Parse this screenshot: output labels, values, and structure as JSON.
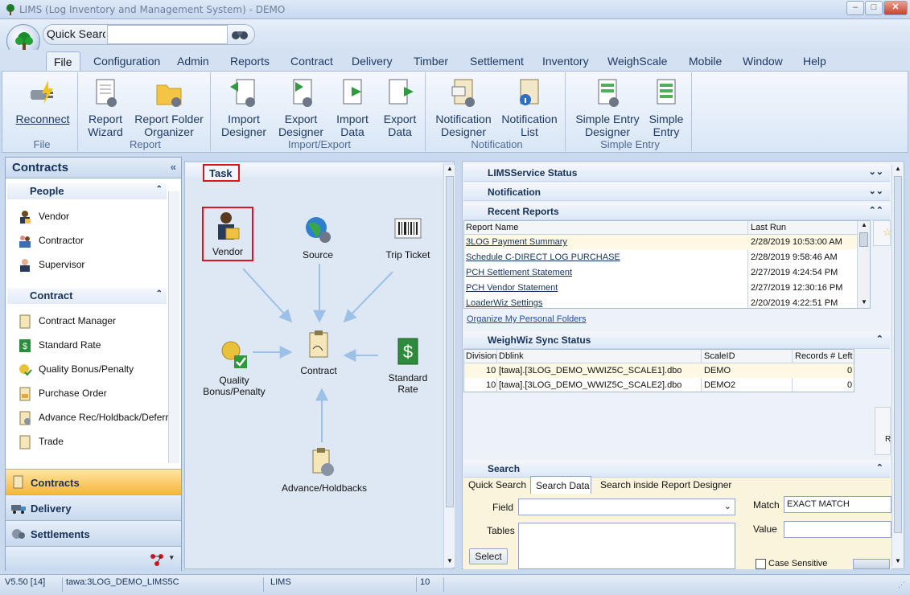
{
  "window": {
    "title": "LIMS (Log Inventory and Management System) - DEMO"
  },
  "quick_search": {
    "label": "Quick Search",
    "value": ""
  },
  "menu_tabs": [
    "File",
    "Configuration",
    "Admin",
    "Reports",
    "Contract",
    "Delivery",
    "Timber",
    "Settlement",
    "Inventory",
    "WeighScale",
    "Mobile",
    "Window",
    "Help"
  ],
  "ribbon": {
    "groups": [
      "File",
      "Report",
      "Import/Export",
      "Notification",
      "Simple Entry"
    ],
    "buttons": {
      "reconnect": "Reconnect",
      "report_wizard_1": "Report",
      "report_wizard_2": "Wizard",
      "report_folder_1": "Report Folder",
      "report_folder_2": "Organizer",
      "import_designer_1": "Import",
      "import_designer_2": "Designer",
      "export_designer_1": "Export",
      "export_designer_2": "Designer",
      "import_data_1": "Import",
      "import_data_2": "Data",
      "export_data_1": "Export",
      "export_data_2": "Data",
      "notification_designer_1": "Notification",
      "notification_designer_2": "Designer",
      "notification_list_1": "Notification",
      "notification_list_2": "List",
      "simple_entry_designer_1": "Simple Entry",
      "simple_entry_designer_2": "Designer",
      "simple_entry_1": "Simple",
      "simple_entry_2": "Entry"
    }
  },
  "sidebar": {
    "title": "Contracts",
    "people_label": "People",
    "people": [
      "Vendor",
      "Contractor",
      "Supervisor"
    ],
    "contract_label": "Contract",
    "contract_items": [
      "Contract Manager",
      "Standard Rate",
      "Quality Bonus/Penalty",
      "Purchase Order",
      "Advance Rec/Holdback/Deferral",
      "Trade"
    ],
    "bottom_tabs": [
      "Contracts",
      "Delivery",
      "Settlements"
    ]
  },
  "task": {
    "title": "Task",
    "nodes": {
      "vendor": "Vendor",
      "source": "Source",
      "trip_ticket": "Trip Ticket",
      "quality": "Quality Bonus/Penalty",
      "contract": "Contract",
      "standard_rate": "Standard Rate",
      "advance": "Advance/Holdbacks"
    }
  },
  "right": {
    "limsservice": "LIMSService Status",
    "notification": "Notification",
    "recent_reports": {
      "title": "Recent Reports",
      "columns": [
        "Report Name",
        "Last Run"
      ],
      "rows": [
        {
          "name": "3LOG Payment Summary",
          "last_run": "2/28/2019 10:53:00 AM"
        },
        {
          "name": "Schedule C-DIRECT LOG PURCHASE",
          "last_run": "2/28/2019 9:58:46 AM"
        },
        {
          "name": "PCH Settlement Statement",
          "last_run": "2/27/2019 4:24:54 PM"
        },
        {
          "name": "PCH Vendor Statement",
          "last_run": "2/27/2019 12:30:16 PM"
        },
        {
          "name": "LoaderWiz Settings",
          "last_run": "2/20/2019 4:22:51 PM"
        }
      ],
      "organize_link": "Organize My Personal Folders"
    },
    "weighwiz": {
      "title": "WeighWiz Sync Status",
      "columns": [
        "Division",
        "Dblink",
        "ScaleID",
        "Records # Left"
      ],
      "rows": [
        {
          "division": "10",
          "dblink": "[tawa].[3LOG_DEMO_WWIZ5C_SCALE1].dbo",
          "scale": "DEMO",
          "left": "0"
        },
        {
          "division": "10",
          "dblink": "[tawa].[3LOG_DEMO_WWIZ5C_SCALE2].dbo",
          "scale": "DEMO2",
          "left": "0"
        }
      ]
    },
    "search": {
      "title": "Search",
      "tabs": [
        "Quick Search",
        "Search Data",
        "Search inside Report Designer"
      ],
      "field_label": "Field",
      "tables_label": "Tables",
      "match_label": "Match",
      "match_value": "EXACT MATCH",
      "value_label": "Value",
      "select_button": "Select",
      "case_sensitive": "Case Sensitive"
    }
  },
  "statusbar": {
    "version": "V5.50 [14]",
    "connection": "tawa:3LOG_DEMO_LIMS5C",
    "app": "LIMS",
    "division": "10"
  }
}
